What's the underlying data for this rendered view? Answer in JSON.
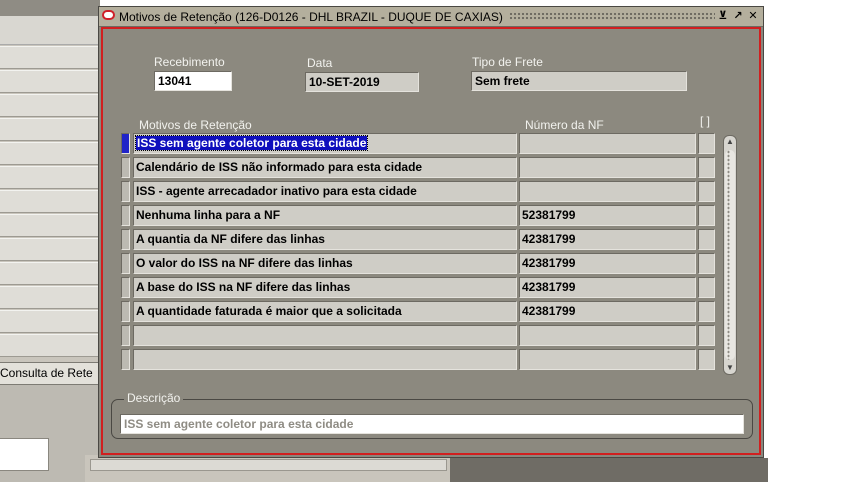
{
  "background": {
    "consulta_button_label": "Consulta de Rete"
  },
  "dialog": {
    "title": "Motivos de Retenção (126-D0126 - DHL BRAZIL - DUQUE DE CAXIAS)",
    "minimize_glyph": "⊻",
    "maximize_glyph": "↗",
    "close_glyph": "✕",
    "labels": {
      "recebimento": "Recebimento",
      "data": "Data",
      "tipo_frete": "Tipo de Frete",
      "motivos": "Motivos de Retenção",
      "numero_nf": "Número da NF",
      "select_col": "[ ]",
      "descricao": "Descrição"
    },
    "values": {
      "recebimento": "13041",
      "data": "10-SET-2019",
      "tipo_frete": "Sem frete",
      "descricao": "ISS sem agente coletor para esta cidade"
    },
    "rows": [
      {
        "motivo": "ISS sem agente coletor para esta cidade",
        "nf": ""
      },
      {
        "motivo": "Calendário de ISS não informado para esta cidade",
        "nf": ""
      },
      {
        "motivo": "ISS - agente arrecadador inativo para esta cidade",
        "nf": ""
      },
      {
        "motivo": "Nenhuma linha para a NF",
        "nf": "52381799"
      },
      {
        "motivo": "A quantia da NF difere das linhas",
        "nf": "42381799"
      },
      {
        "motivo": "O valor do ISS na NF difere das linhas",
        "nf": "42381799"
      },
      {
        "motivo": "A base do ISS na NF difere das linhas",
        "nf": "42381799"
      },
      {
        "motivo": "A quantidade faturada é maior que a solicitada",
        "nf": "42381799"
      },
      {
        "motivo": "",
        "nf": ""
      },
      {
        "motivo": "",
        "nf": ""
      }
    ]
  }
}
